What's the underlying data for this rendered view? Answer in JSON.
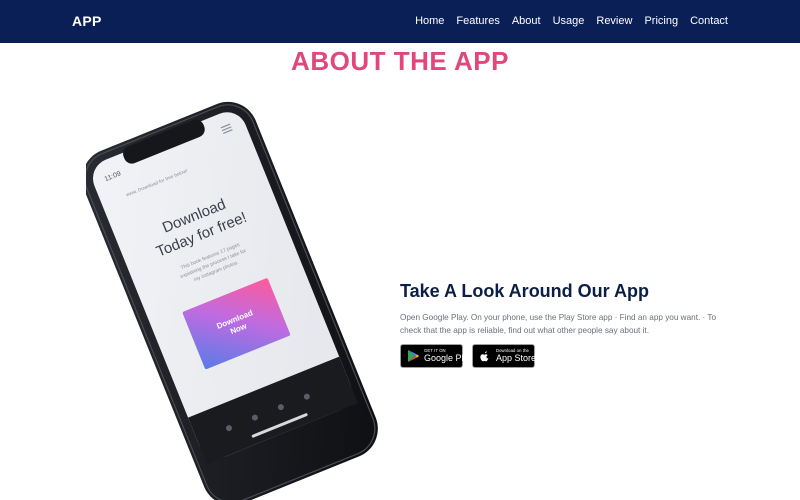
{
  "navbar": {
    "brand": "APP",
    "links": [
      "Home",
      "Features",
      "About",
      "Usage",
      "Review",
      "Pricing",
      "Contact"
    ]
  },
  "section": {
    "title": "ABOUT THE APP"
  },
  "phone": {
    "time": "11:09",
    "url_text": "www. Download for free below!",
    "headline_line1": "Download",
    "headline_line2": "Today for free!",
    "body_line1": "This book features 17 pages",
    "body_line2": "explaining the process I take for",
    "body_line3": "my instagram photos.",
    "cta_line1": "Download",
    "cta_line2": "Now"
  },
  "about": {
    "heading": "Take A Look Around Our App",
    "description": "Open Google Play. On your phone, use the Play Store app · Find an app you want. · To check that the app is reliable, find out what other people say about it.",
    "google_play": {
      "small": "GET IT ON",
      "big": "Google Play"
    },
    "app_store": {
      "small": "Download on the",
      "big": "App Store"
    }
  },
  "colors": {
    "navbar_bg": "#0b1f57",
    "title_pink": "#e0487a",
    "heading_navy": "#0b1f45"
  }
}
